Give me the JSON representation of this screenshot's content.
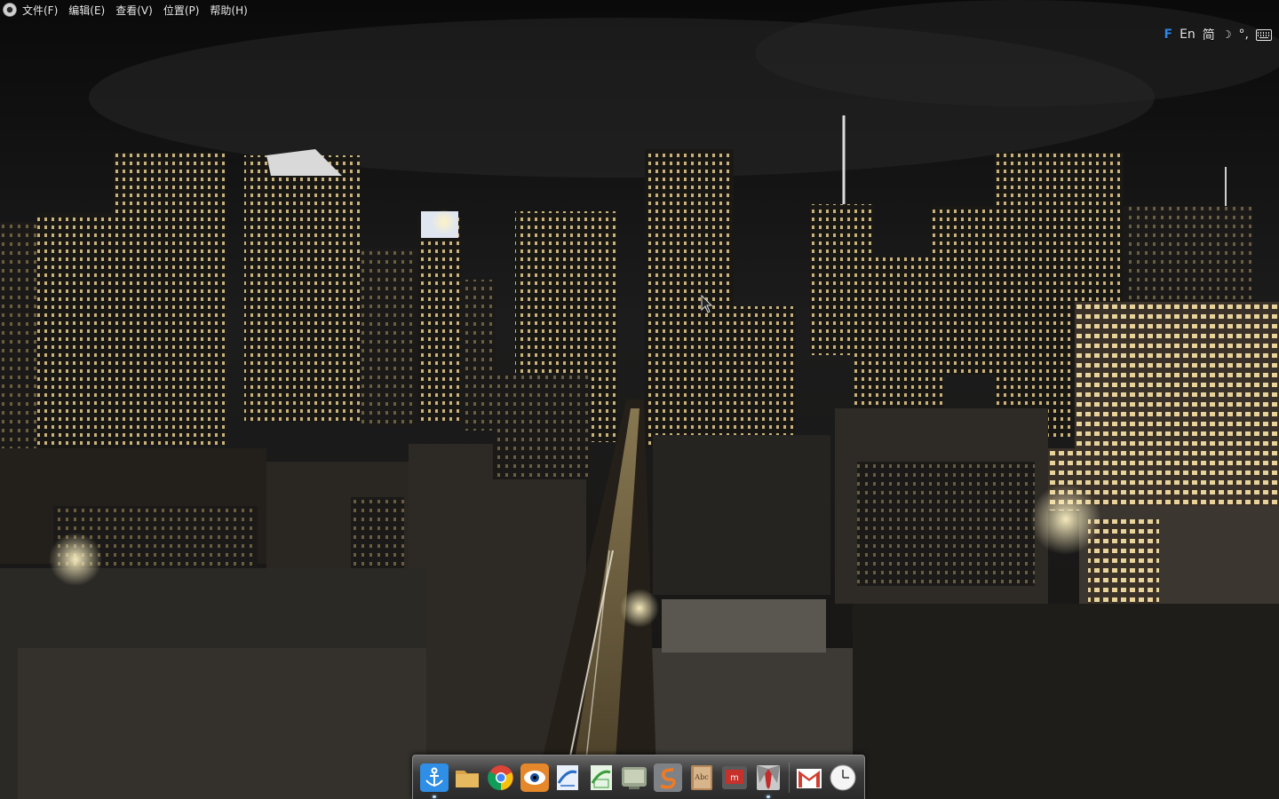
{
  "menubar": {
    "items": [
      "文件(F)",
      "编辑(E)",
      "查看(V)",
      "位置(P)",
      "帮助(H)"
    ]
  },
  "tray": {
    "ime_lang": "En",
    "ime_mode": "简",
    "punct": "°,"
  },
  "dock": {
    "items": [
      {
        "name": "anchor",
        "running": true
      },
      {
        "name": "folder",
        "running": false
      },
      {
        "name": "chrome",
        "running": false
      },
      {
        "name": "eye",
        "running": false
      },
      {
        "name": "writer",
        "running": false
      },
      {
        "name": "calc",
        "running": false
      },
      {
        "name": "terminal",
        "running": false
      },
      {
        "name": "scribus",
        "running": false
      },
      {
        "name": "dictionary",
        "running": false
      },
      {
        "name": "presentation",
        "running": false
      },
      {
        "name": "tie",
        "running": true
      },
      {
        "name": "gmail",
        "running": false
      },
      {
        "name": "clock",
        "running": false
      }
    ]
  },
  "colors": {
    "menu_text": "#e9e9e9",
    "tray_text": "#e6e6e6",
    "ime_logo": "#2f86e5"
  }
}
